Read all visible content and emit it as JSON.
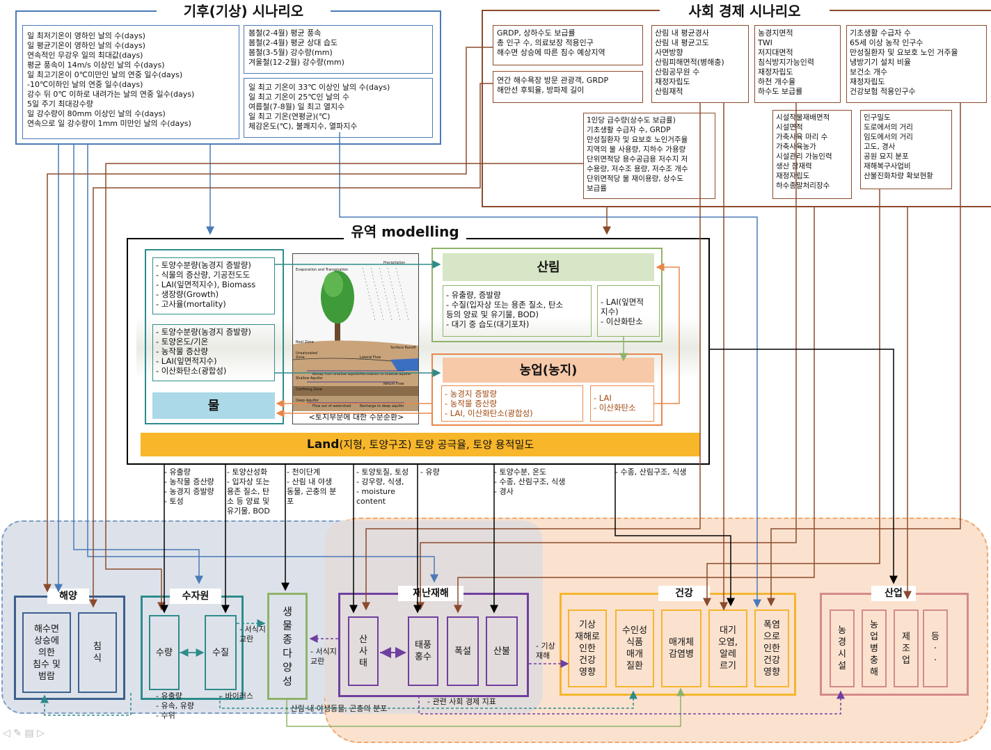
{
  "climate": {
    "title": "기후(기상) 시나리오",
    "box1": "일 최저기온이 영하인 날의 수(days)\n일 평균기온이 영하인 날의 수(days)\n연속적인 무강우 일의 최대값(days)\n평균 풍속이 14m/s 이상인 날의 수(days)\n일 최고기온이 0℃미만인 날의 연중 일수(days)\n-10℃이하인 날의 연중 일수(days)\n강수 뒤 0℃ 이하로 내려가는 날의 연중 일수(days)\n5일 주기 최대강수량\n일 강수량이 80mm 이상인 날의 수(days)\n연속으로 일 강수량이 1mm 미만인 날의 수(days)",
    "box2": "봄철(2-4월) 평균 풍속\n봄철(2-4월) 평균 상대 습도\n봄철(3-5월) 강수량(mm)\n겨울철(12-2월) 강수량(mm)",
    "box3": "일 최고 기온이 33℃ 이상인 날의 수(days)\n일 최고 기온이 25℃인 날의 수\n여름철(7-8월) 일 최고 열지수\n일 최고 기온(연평균)(℃)\n체감온도(℃), 불쾌지수, 열파지수"
  },
  "socio": {
    "title": "사회 경제 시나리오",
    "box1": "GRDP, 상하수도 보급률\n총 인구 수, 의료보장 적용인구\n해수면 상승에 따른 침수 예상지역",
    "box2": "연간 해수욕장 방문 관광객, GRDP\n해안선 후퇴율, 방파제 길이",
    "box3": "산림 내 평균경사\n산림 내 평균고도\n사면방향\n산림피해면적(병해충)\n산림공무원 수\n재정자립도\n산림재적",
    "box4": "농경지면적\nTWI\n저지대면적\n침식방지가능인력\n재정자립도\n하천 개수율\n하수도 보급률",
    "box5": "기초생활 수급자 수\n65세 이상 농작 인구수\n만성질환자 및 요보호 노인 거주율\n냉방기기 설치 비율\n보건소 개수\n재정자립도\n건강보험 적용인구수",
    "box6": "1인당 급수량(상수도 보급률)\n기초생활 수급자 수, GRDP\n만성질환자 및 요보호 노인거주율\n지역의 물 사용량, 지하수 가용량\n단위면적당 용수공급용 저수지 저\n수용량, 저수조 용량, 저수조 개수\n단위면적당 물 재이용량, 상수도\n보급률",
    "box7": "시설작물재배면적\n시설면적\n가축사육 마리 수\n가축사육농가\n시설관리 가능인력\n생산 잠재력\n재정자립도\n하수종말처리장수",
    "box8": "인구밀도\n도로에서의 거리\n임도에서의 거리\n고도, 경사\n공원 묘지 분포\n재해복구사업비\n산불진화차량 확보현황"
  },
  "model": {
    "title": "유역 modelling",
    "veg_list": "- 토양수분량(농경지 증발량)\n- 식물의 증산량, 기공전도도\n- LAI(잎면적지수), Biomass\n- 생장량(Growth)\n- 고사율(mortality)",
    "agri_list": "- 토양수분량(농경지 증발량)\n- 토양온도/기온\n- 농작물 증산량\n- LAI(잎면적지수)\n- 이산화탄소(광합성)",
    "water": "물",
    "fig_caption": "<토지부문에 대한 수문순환>",
    "forest": "산림",
    "forest_list": "- 유출량, 증발량\n- 수질(입자상 또는 용존 질소, 탄소\n등의 양료 및 유기물, BOD)\n- 대기 중 습도(대기포차)",
    "forest_side": "- LAI(잎면적\n지수)\n- 이산화탄소",
    "agri": "농업(농지)",
    "agri2_list": "- 농경지 증발량\n- 농작물 증산량\n- LAI, 이산화탄소(광합성)",
    "agri2_side": "- LAI\n- 이산화탄소",
    "land_bold": "Land",
    "land_rest": "(지형, 토양구조) 토양 공극율, 토양 용적밀도",
    "fig_labels": [
      "Evaporation and Transpiration",
      "Precipitation",
      "Root Zone",
      "Unsaturated Zone",
      "Shallow Aquifer",
      "Confining Zone",
      "Deep Aquifer",
      "Surface Runoff",
      "Lateral Flow",
      "Revap from shallow aquifer",
      "Percolation to shallow aquifer",
      "Return Flow",
      "Flow out of watershed",
      "Recharge to deep aquifer"
    ]
  },
  "edges": {
    "e1": "- 유출량\n- 농작물 증산량\n- 농경지 증발량\n- 토성",
    "e2": "- 토양산성화\n- 입자상 또는\n용존 질소, 탄\n소 등 양료 및\n유기물, BOD",
    "e3": "- 천이단계\n- 산림 내 야생\n동물, 곤충의 분\n포",
    "e4": "- 토양토질, 토성\n- 강우량, 식생,\n- moisture content",
    "e5": "- 유량",
    "e6": "- 토양수분, 온도\n- 수종, 산림구조, 식생\n- 경사",
    "e7": "- 수종, 산림구조, 식생",
    "b1": "- 유출량\n- 유속, 유량\n- 수위",
    "b2": "- 바이러스",
    "b3": "- 산림 내 야생동물, 곤충의 분포",
    "b4": "- 관련 사회 경제 지표",
    "h1": "- 서식지\n교란",
    "h2": "- 서식지\n교란",
    "h3": "- 기상\n재해"
  },
  "sectors": {
    "ocean": {
      "title": "해양",
      "items": [
        "해수면\n상승에\n의한\n침수 및\n범람",
        "침\n식"
      ]
    },
    "water": {
      "title": "수자원",
      "items": [
        "수량",
        "수질"
      ]
    },
    "bio": {
      "label": "생\n물\n종\n다\n양\n성"
    },
    "disaster": {
      "title": "재난재해",
      "items": [
        "산\n사\n태",
        "태풍\n홍수",
        "폭설",
        "산불"
      ]
    },
    "health": {
      "title": "건강",
      "items": [
        "기상\n재해로\n인한\n건강\n영향",
        "수인성\n식품\n매개\n질환",
        "매개체\n감염병",
        "대기\n오염,\n알레\n르기",
        "폭염\n으로\n인한\n건강\n영향"
      ]
    },
    "industry": {
      "title": "산업",
      "items": [
        "농\n경\n시\n설",
        "농\n업\n병\n충\n해",
        "제\n조\n업",
        "등\n·\n·"
      ]
    }
  },
  "colors": {
    "climate": "#4a7ab7",
    "socio": "#8b4a2b",
    "water_sector": "#2e8b8b",
    "bio": "#8fb36a",
    "disaster": "#6f3fa0",
    "health": "#f5b52c",
    "industry": "#d48a8a",
    "ocean": "#3b5f8f"
  }
}
